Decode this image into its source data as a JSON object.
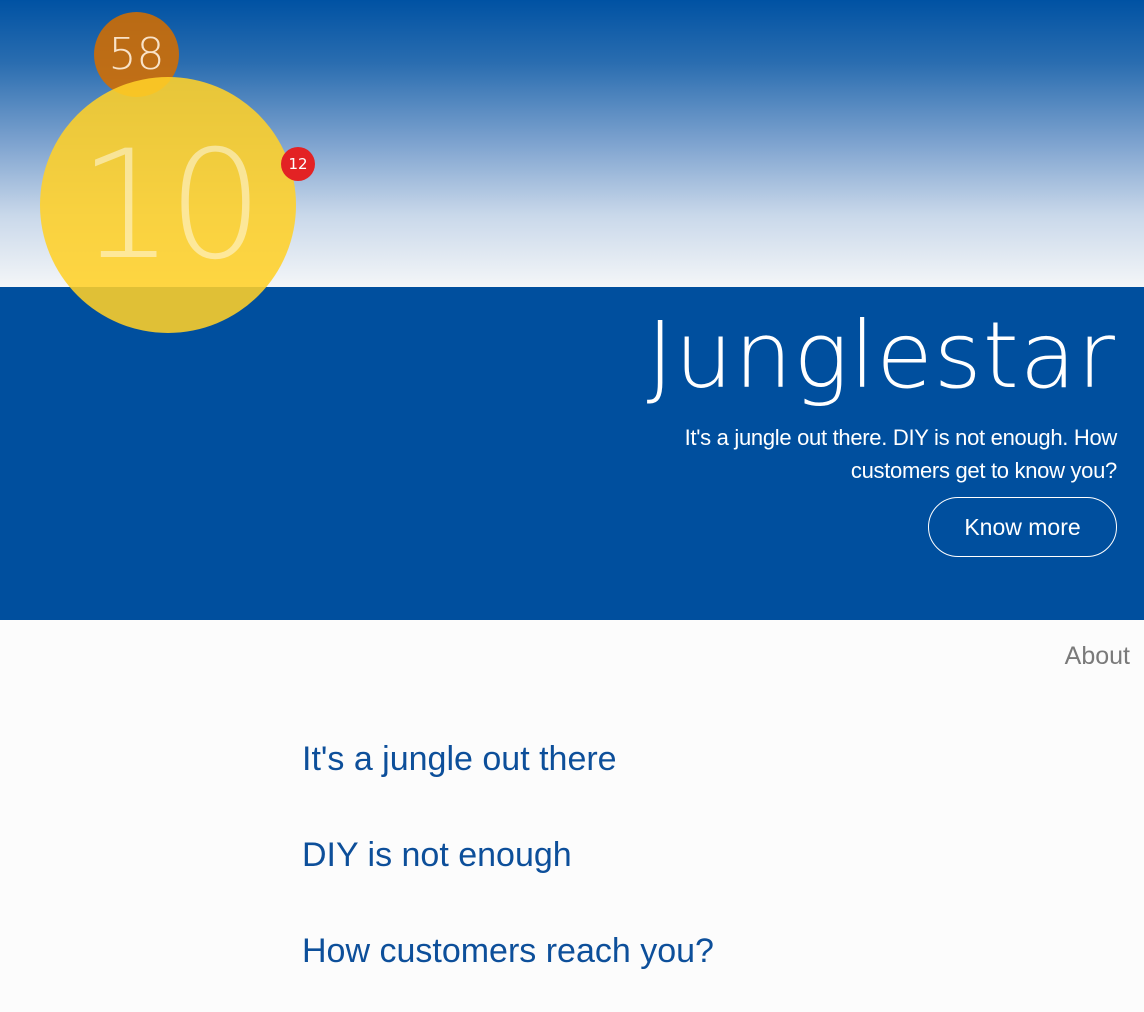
{
  "badges": {
    "sun_value": "10",
    "orange_value": "58",
    "red_value": "12"
  },
  "hero": {
    "brand": "Junglestar",
    "tagline": "It's a jungle out there. DIY is not enough. How customers get to know you?",
    "cta_label": "Know more"
  },
  "nav": {
    "about_label": "About"
  },
  "sections": [
    {
      "title": "It's a jungle out there"
    },
    {
      "title": "DIY is not enough"
    },
    {
      "title": "How customers reach you?"
    }
  ],
  "colors": {
    "hero_blue": "#004f9e",
    "sun_yellow": "#ffd028",
    "orange": "#d36d00",
    "badge_red": "#e32224",
    "heading_blue": "#0d4f9a"
  }
}
